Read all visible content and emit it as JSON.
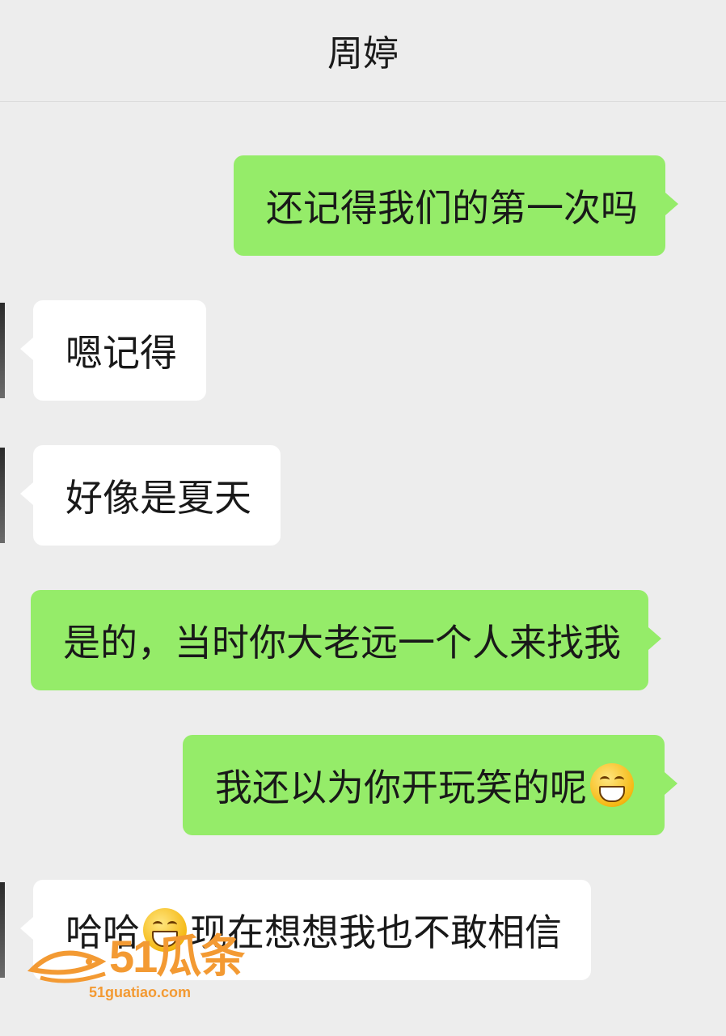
{
  "header": {
    "title": "周婷"
  },
  "messages": [
    {
      "side": "out",
      "text": "还记得我们的第一次吗"
    },
    {
      "side": "in",
      "text": "嗯记得"
    },
    {
      "side": "in",
      "text": "好像是夏天"
    },
    {
      "side": "out",
      "text": "是的，当时你大老远一个人来找我"
    },
    {
      "side": "out",
      "text": "我还以为你开玩笑的呢",
      "emoji": "grinning-emoji"
    },
    {
      "side": "in",
      "text_before": "哈哈",
      "emoji": "grinning-emoji",
      "text_after": "现在想想我也不敢相信"
    }
  ],
  "watermark": {
    "logo": "51瓜条",
    "site": "51guatiao.com"
  },
  "colors": {
    "background": "#ededed",
    "outgoing_bubble": "#95ec69",
    "incoming_bubble": "#ffffff",
    "watermark": "#f39a33"
  }
}
